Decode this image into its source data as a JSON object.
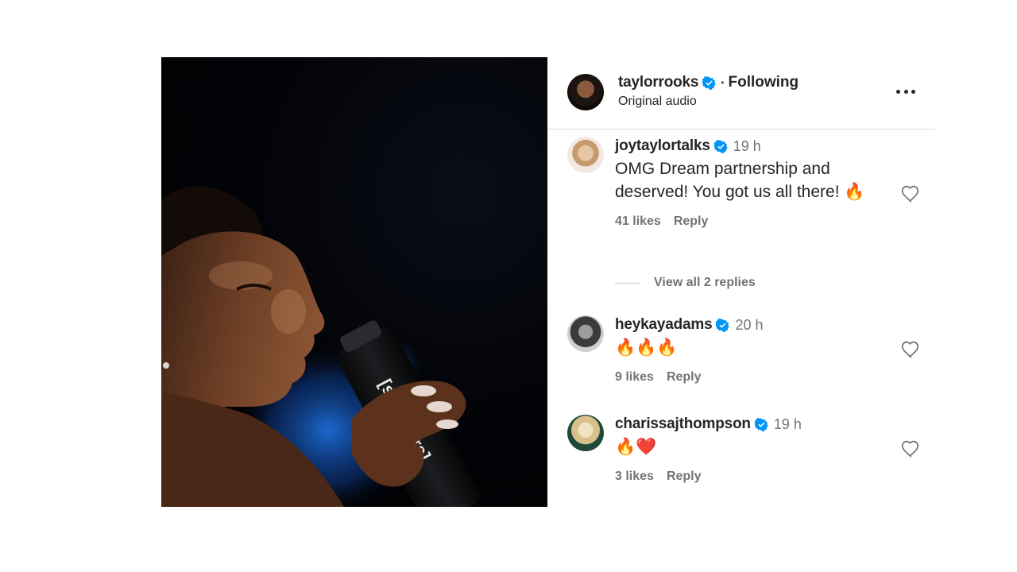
{
  "post": {
    "author": {
      "username": "taylorrooks",
      "verified": true,
      "follow_status": "Following",
      "separator": "•",
      "subtitle": "Original audio"
    },
    "more_icon": "more-horizontal-icon",
    "media": {
      "bottle_text": "[solidcore]"
    }
  },
  "colors": {
    "verified_blue": "#0095f6",
    "muted_text": "#737373",
    "divider": "#dbdbdb"
  },
  "comments": [
    {
      "username": "joytaylortalks",
      "verified": true,
      "time": "19 h",
      "text": "OMG Dream partnership and deserved! You got us all there! 🔥",
      "likes": "41 likes",
      "reply_label": "Reply",
      "view_replies": "View all 2 replies"
    },
    {
      "username": "heykayadams",
      "verified": true,
      "time": "20 h",
      "text": "🔥🔥🔥",
      "likes": "9 likes",
      "reply_label": "Reply"
    },
    {
      "username": "charissajthompson",
      "verified": true,
      "time": "19 h",
      "text": "🔥❤️",
      "likes": "3 likes",
      "reply_label": "Reply"
    }
  ]
}
